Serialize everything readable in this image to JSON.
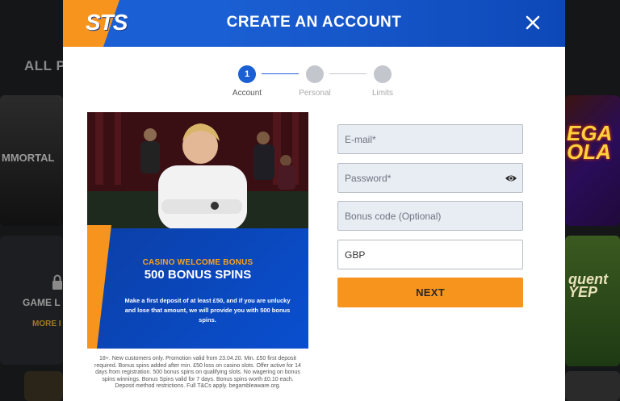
{
  "background": {
    "section_title": "ALL P",
    "tile_left_1": "MMORTAL",
    "tile_left_2_label": "GAME L",
    "tile_left_2_more": "MORE I",
    "tile_right_1": "EGA\nOLA",
    "tile_right_2": "quent\nYEP"
  },
  "modal": {
    "logo": "STS",
    "title": "CREATE AN ACCOUNT",
    "close_icon": "close-icon",
    "steps": [
      {
        "number": "1",
        "label": "Account",
        "active": true
      },
      {
        "number": "",
        "label": "Personal",
        "active": false
      },
      {
        "number": "",
        "label": "Limits",
        "active": false
      }
    ],
    "promo": {
      "subtitle": "CASINO WELCOME BONUS",
      "headline": "500 BONUS SPINS",
      "body": "Make a first deposit of at least £50, and if you are unlucky and lose that amount, we will provide you with 500 bonus spins."
    },
    "terms": "18+. New customers only. Promotion valid from 23.04.20. Min. £50 first deposit required. Bonus spins added after min. £50 loss on casino slots. Offer active for 14 days from registration. 500 bonus spins on qualifying slots. No wagering on bonus spins winnings. Bonus Spins valid for 7 days. Bonus spins worth £0.10 each. Deposit method restrictions. Full T&Cs apply. begambleaware.org.",
    "form": {
      "email_placeholder": "E-mail*",
      "password_placeholder": "Password*",
      "bonus_placeholder": "Bonus code (Optional)",
      "currency_value": "GBP",
      "next_label": "NEXT"
    }
  },
  "colors": {
    "brand_blue": "#1a5fd3",
    "brand_orange": "#f7941d"
  }
}
